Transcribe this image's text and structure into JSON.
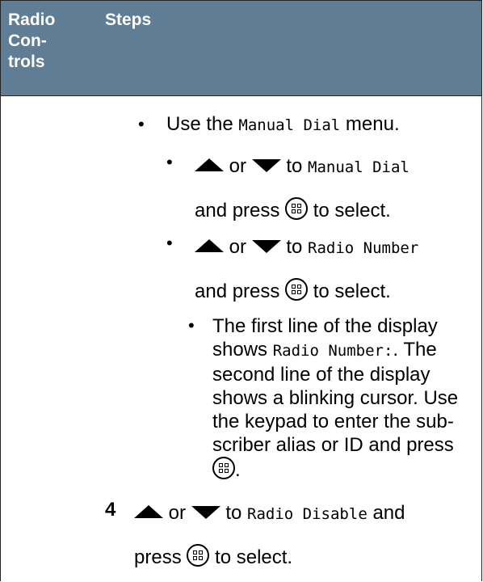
{
  "header": {
    "col1": "Radio\nCon-\ntrols",
    "col2": "Steps"
  },
  "steps": {
    "manual_dial_pre": "Use the",
    "manual_dial_menu": "Manual Dial",
    "manual_dial_post": "menu.",
    "or": "or",
    "to": "to",
    "manual_dial_target": "Manual Dial",
    "and_press": "and press",
    "to_select": "to select.",
    "radio_number_target": "Radio Number",
    "display_line1_a": "The first line of the display",
    "display_line2_a": "shows",
    "display_radio_number_colon": "Radio Number:",
    "display_line2_b": ". The",
    "display_line3": "second line of the display",
    "display_line4": "shows a blinking cursor. Use",
    "display_line5": "the keypad to enter the sub-",
    "display_line6": "scriber alias or ID and press",
    "display_end": ".",
    "step4_num": "4",
    "radio_disable_target": "Radio Disable",
    "and": "and",
    "press": "press"
  },
  "icons": {
    "up": "up-arrow-icon",
    "down": "down-arrow-icon",
    "menu_ok": "menu-ok-button-icon"
  },
  "colors": {
    "header_bg": "#5f7d95",
    "header_text": "#ffffff"
  }
}
